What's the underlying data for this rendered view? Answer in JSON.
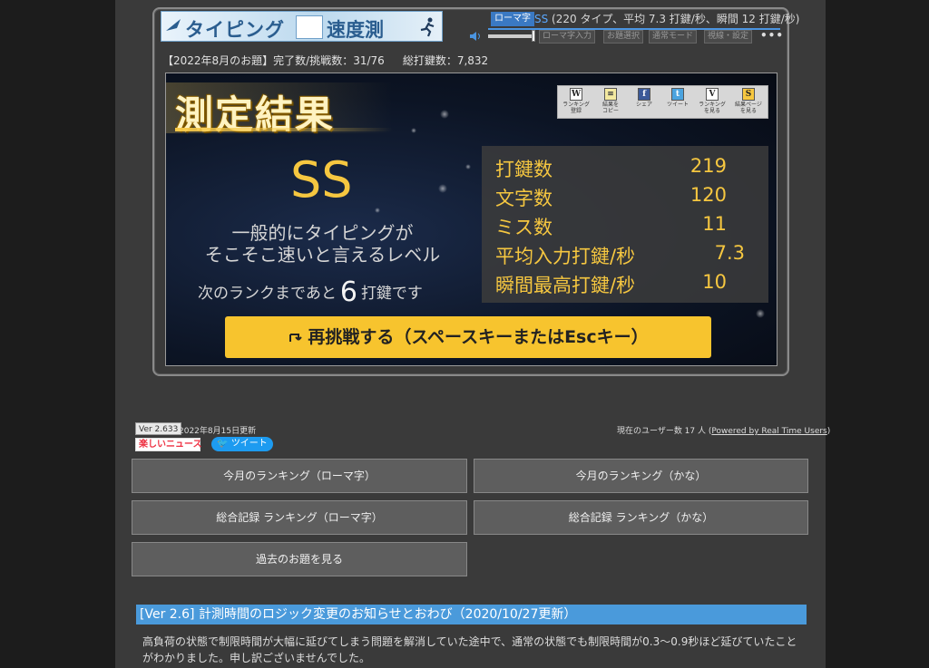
{
  "header": {
    "logo_left": "タイピング",
    "logo_right": "速度測",
    "mode_badge": "ローマ字",
    "rank": "SS",
    "summary": " (220 タイプ、平均 7.3 打鍵/秒、瞬間 12 打鍵/秒)",
    "buttons": [
      "ローマ字入力",
      "お題選択",
      "通常モード",
      "視線・設定"
    ],
    "more": "•••"
  },
  "info": {
    "theme": "【2022年8月のお題】完了数/挑戦数：31/76",
    "total": "総打鍵数：7,832"
  },
  "result": {
    "title": "測定結果",
    "share": [
      {
        "icon": "W",
        "label": "ランキング\n登録",
        "color": "#ffffff"
      },
      {
        "icon": "≡",
        "label": "結果を\nコピー",
        "color": "#f3e9a0"
      },
      {
        "icon": "f",
        "label": "シェア",
        "color": "#3b5998"
      },
      {
        "icon": "t",
        "label": "ツイート",
        "color": "#4aa3df"
      },
      {
        "icon": "V",
        "label": "ランキング\nを見る",
        "color": "#ffffff"
      },
      {
        "icon": "S",
        "label": "結果ページ\nを見る",
        "color": "#f6c740"
      }
    ],
    "rank": "SS",
    "comment_line1": "一般的にタイピングが",
    "comment_line2": "そこそこ速いと言えるレベル",
    "next_prefix": "次のランクまであと",
    "next_num": "6",
    "next_suffix": "打鍵です",
    "stats": [
      {
        "label": "打鍵数",
        "value": "219"
      },
      {
        "label": "文字数",
        "value": "120"
      },
      {
        "label": "ミス数",
        "value": "11"
      },
      {
        "label": "平均入力打鍵/秒",
        "value": "7.3"
      },
      {
        "label": "瞬間最高打鍵/秒",
        "value": "10"
      }
    ],
    "retry_label": "再挑戦する（スペースキーまたはEscキー）"
  },
  "footer": {
    "version": "Ver 2.633",
    "updated": "2022年8月15日更新",
    "users_prefix": "現在のユーザー数 17 人 (",
    "users_link": "Powered by Real Time Users",
    "users_suffix": ")",
    "news_logo": "楽しいニュース",
    "tweet": "ツイート",
    "buttons": [
      "今月のランキング（ローマ字）",
      "今月のランキング（かな）",
      "総合記録 ランキング（ローマ字）",
      "総合記録 ランキング（かな）",
      "過去のお題を見る"
    ]
  },
  "notice": {
    "title": "[Ver 2.6] 計測時間のロジック変更のお知らせとおわび（2020/10/27更新）",
    "body": "高負荷の状態で制限時間が大幅に延びてしまう問題を解消していた途中で、通常の状態でも制限時間が0.3〜0.9秒ほど延びていたことがわかりました。申し訳ございませんでした。"
  }
}
